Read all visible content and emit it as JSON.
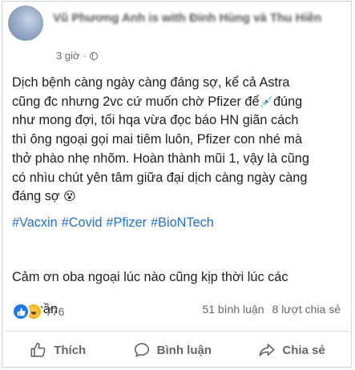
{
  "post": {
    "author": "Vũ Phương Anh is with Đinh Hùng và Thu Hiền",
    "time": "3 giờ",
    "separator": "·",
    "privacy_icon": "globe-icon",
    "text_lines": [
      "Dịch bệnh càng ngày càng đáng sợ, kể cả Astra",
      "cũng đc nhưng 2vc cứ muốn chờ Pfizer để",
      "đúng",
      "như mong đợi, tối hqa vừa đọc báo HN giãn cách",
      "thì ông ngoại gọi mai tiêm luôn, Pfizer con nhé mà",
      "thở phào nhẹ nhõm. Hoàn thành mũi 1, vậy là cũng",
      "có nhìu chút yên tâm giữa đại dịch càng ngày càng",
      "đáng sợ"
    ],
    "hashtags": [
      "#Vacxin",
      "#Covid",
      "#Pfizer",
      "#BioNTech"
    ],
    "text2_lines": [
      "Cảm ơn oba ngoại lúc nào cũng kịp thời lúc các",
      "con cần"
    ]
  },
  "reactions": {
    "count": "776",
    "types": [
      "like",
      "haha"
    ]
  },
  "stats": {
    "comments": "51 bình luận",
    "shares": "8 lượt chia sẻ"
  },
  "actions": {
    "like_label": "Thích",
    "comment_label": "Bình luận",
    "share_label": "Chia sẻ"
  },
  "colors": {
    "hashtag": "#216fdb",
    "secondary_text": "#65676b",
    "like_blue": "#1877f2"
  }
}
